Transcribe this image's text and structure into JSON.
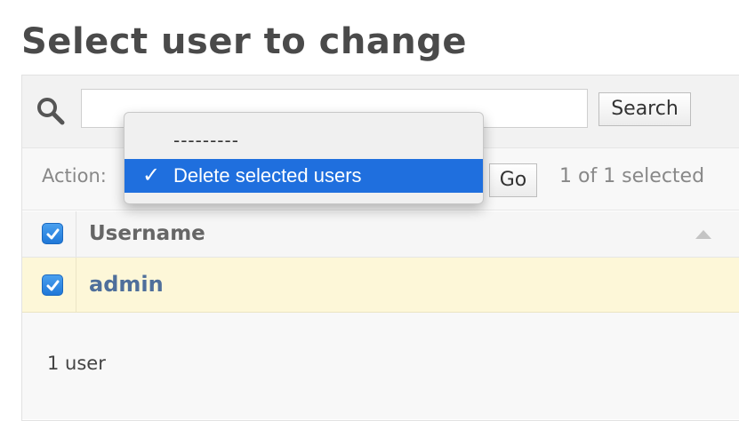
{
  "page_title": "Select user to change",
  "search": {
    "value": "",
    "placeholder": "",
    "button_label": "Search"
  },
  "actions": {
    "label": "Action:",
    "go_label": "Go",
    "selection_count": "1 of 1 selected",
    "options": [
      "---------",
      "Delete selected users"
    ],
    "selected_option": "Delete selected users"
  },
  "table": {
    "columns": [
      "Username"
    ],
    "rows": [
      {
        "username": "admin",
        "checked": true
      }
    ],
    "select_all_checked": true
  },
  "footer": {
    "result_count": "1 user"
  },
  "colors": {
    "accent": "#1f6fde",
    "row_highlight": "#fdf7d8",
    "link": "#4f6f9b"
  }
}
